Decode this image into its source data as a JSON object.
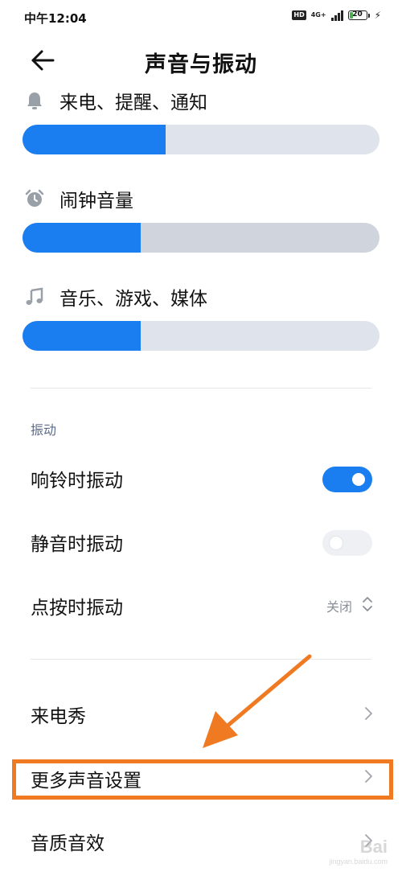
{
  "status_bar": {
    "time": "中午12:04",
    "hd_label": "HD",
    "network_type": "4G+",
    "battery_level": "20"
  },
  "header": {
    "title": "声音与振动"
  },
  "volumes": [
    {
      "label": "来电、提醒、通知",
      "icon": "bell-icon",
      "level_percent": 40
    },
    {
      "label": "闹钟音量",
      "icon": "alarm-clock-icon",
      "level_percent": 33
    },
    {
      "label": "音乐、游戏、媒体",
      "icon": "music-note-icon",
      "level_percent": 33
    }
  ],
  "vibration_section": {
    "caption": "振动",
    "ring_vibrate": {
      "label": "响铃时振动",
      "enabled": true
    },
    "silent_vibrate": {
      "label": "静音时振动",
      "enabled": false
    },
    "touch_vibrate": {
      "label": "点按时振动",
      "value": "关闭"
    }
  },
  "menu": {
    "caller_show": "来电秀",
    "more_sound_settings": "更多声音设置",
    "sound_quality": "音质音效"
  },
  "annotation": {
    "highlight_color": "#f07a22"
  },
  "watermark": {
    "logo": "Bai",
    "url": "jingyan.baidu.com"
  },
  "colors": {
    "accent": "#1a7ef0",
    "track": "#dfe3ec",
    "caption": "#5c6b8a"
  }
}
